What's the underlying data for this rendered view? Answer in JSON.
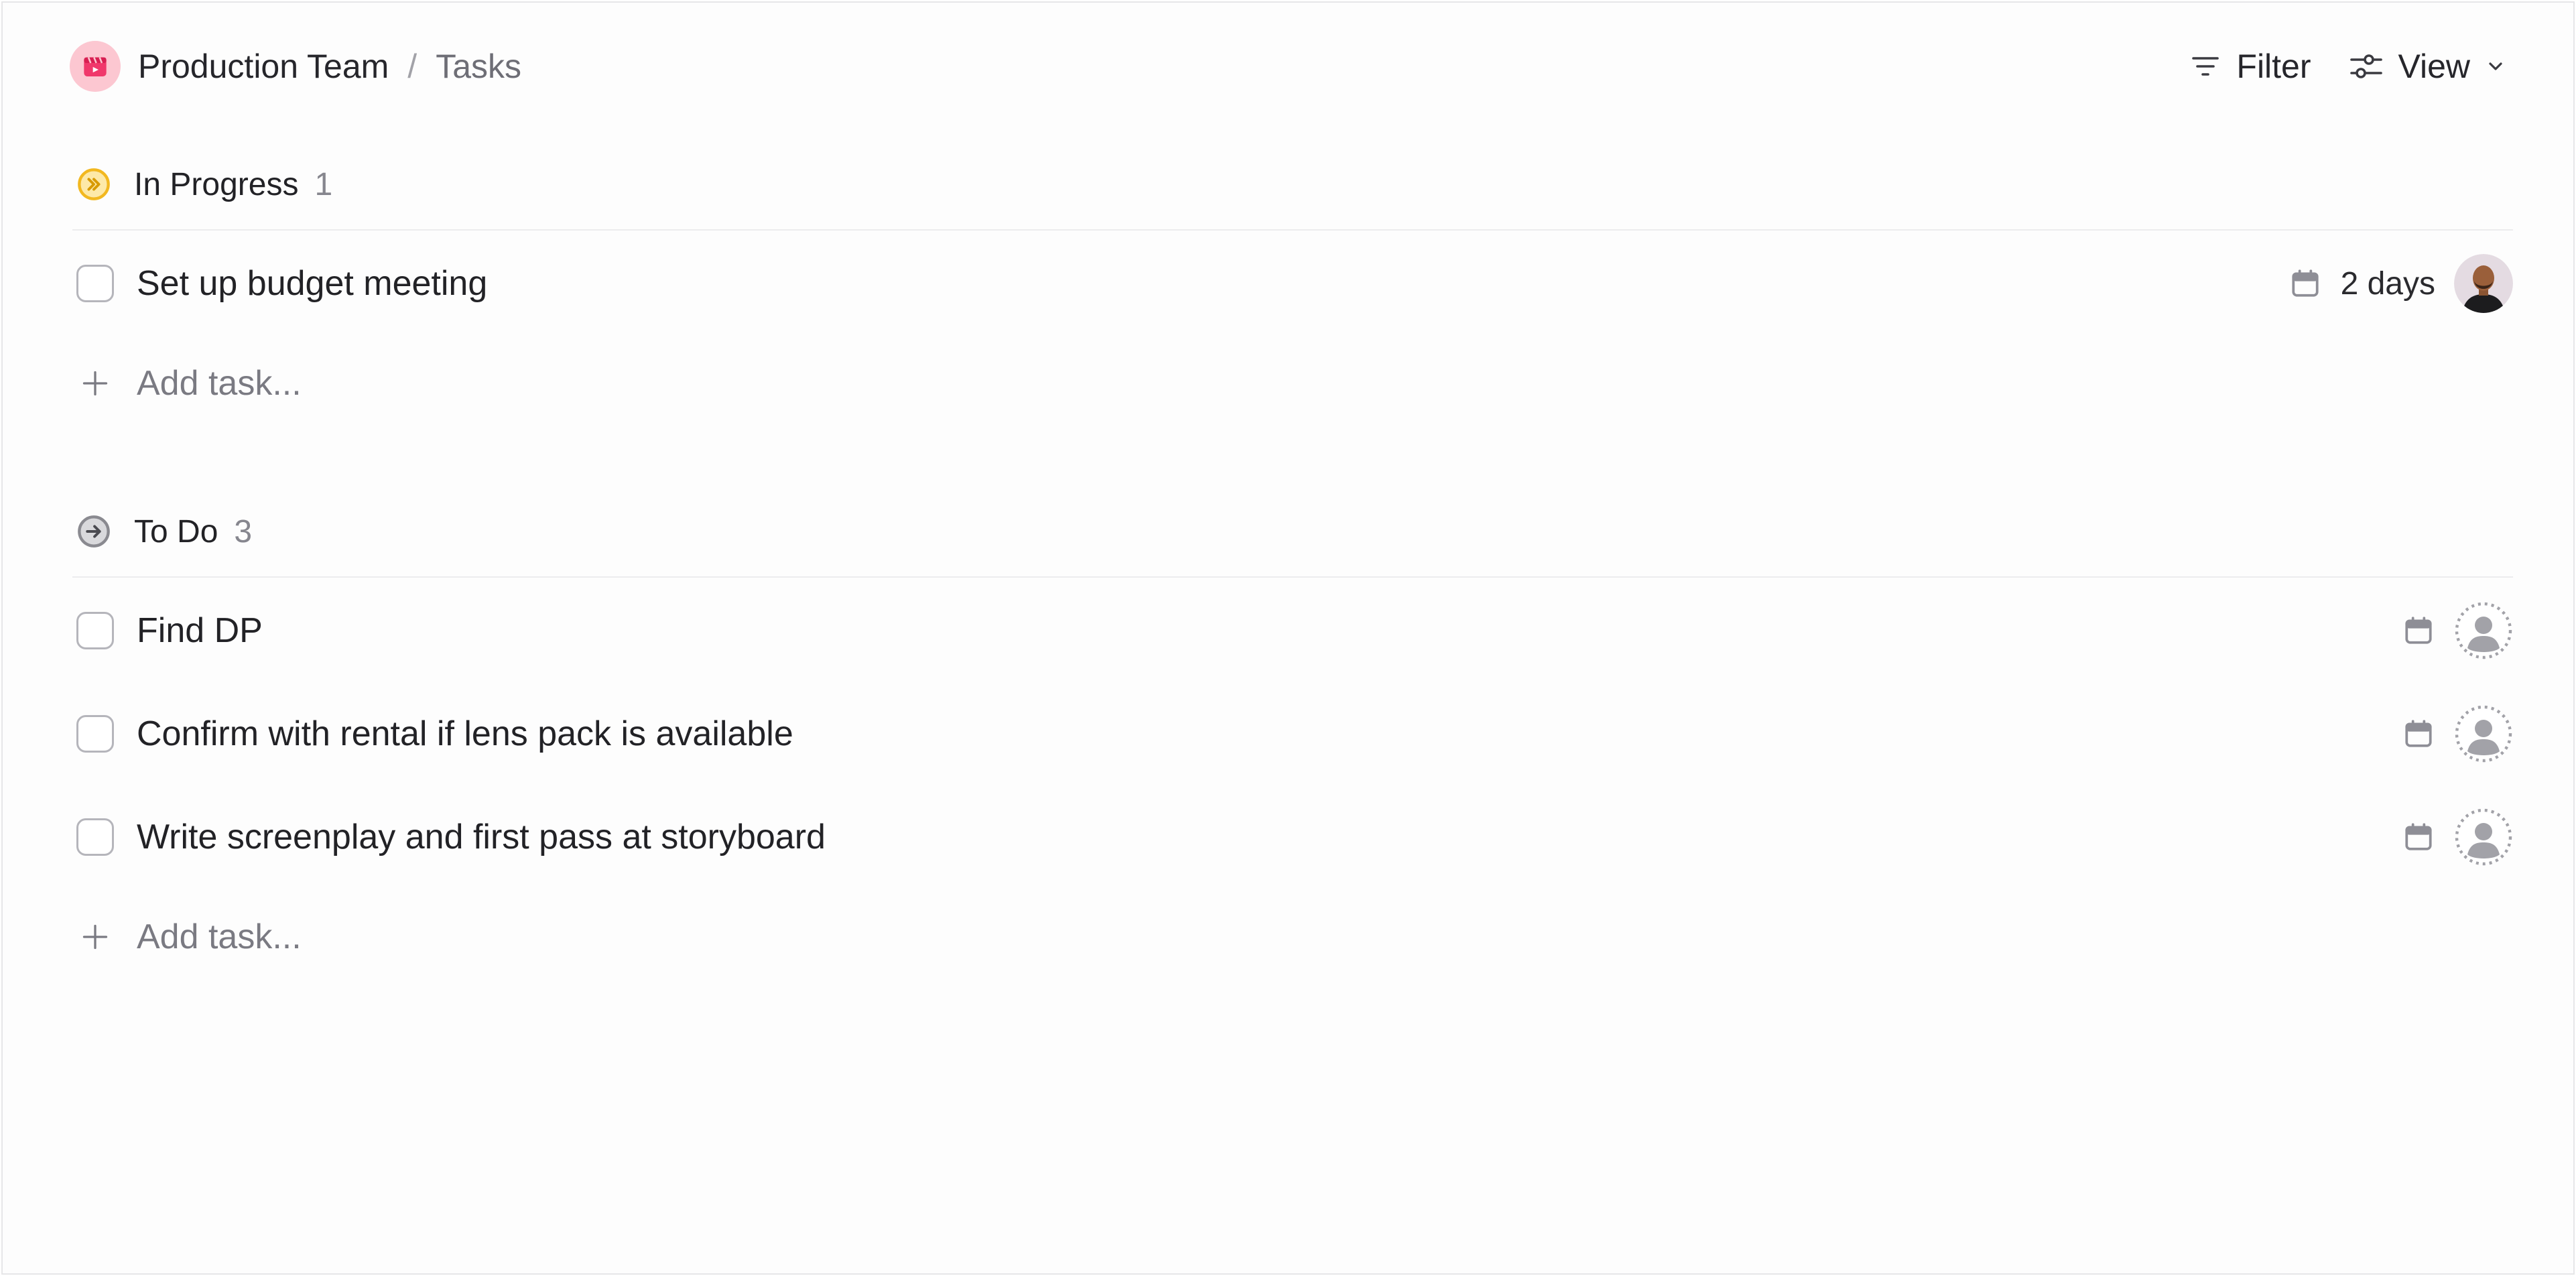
{
  "breadcrumb": {
    "team": "Production Team",
    "separator": "/",
    "page": "Tasks",
    "team_icon": "clapperboard-icon",
    "team_color": "#f0386b"
  },
  "toolbar": {
    "filter_label": "Filter",
    "view_label": "View"
  },
  "groups": [
    {
      "title": "In Progress",
      "count": "1",
      "status_icon": "in-progress-icon",
      "status_color": "#f2b820",
      "tasks": [
        {
          "title": "Set up budget meeting",
          "due": "2 days",
          "assignee": "user-photo"
        }
      ],
      "add_label": "Add task..."
    },
    {
      "title": "To Do",
      "count": "3",
      "status_icon": "todo-icon",
      "status_color": "#8a8a90",
      "tasks": [
        {
          "title": "Find DP",
          "due": "",
          "assignee": "unassigned"
        },
        {
          "title": "Confirm with rental if lens pack is available",
          "due": "",
          "assignee": "unassigned"
        },
        {
          "title": "Write screenplay and first pass at storyboard",
          "due": "",
          "assignee": "unassigned"
        }
      ],
      "add_label": "Add task..."
    }
  ]
}
